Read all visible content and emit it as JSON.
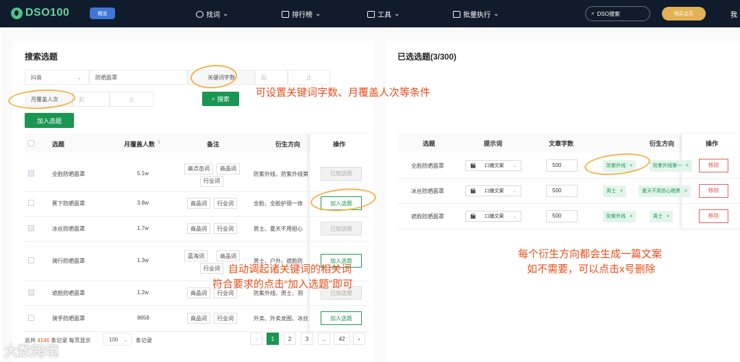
{
  "topbar": {
    "logo": "DSO100",
    "overview": "概览",
    "nav": [
      "找词",
      "排行榜",
      "工具",
      "批量执行"
    ],
    "search_placeholder": "DSO搜索",
    "buy": "购买会员",
    "me": "我"
  },
  "left": {
    "title": "搜索选题",
    "platform": "抖音",
    "keyword": "防晒面罩",
    "kw_len_label": "关键词字数",
    "kw_len_from": "起",
    "kw_len_to": "止",
    "cover_label": "月覆盖人次",
    "cover_from": "起",
    "cover_to": "止",
    "search_btn": "搜索",
    "add_btn": "加入选题",
    "headers": [
      "选题",
      "月覆盖人数",
      "备注",
      "衍生方向",
      "操作"
    ],
    "rows": [
      {
        "name": "全脸防晒面罩",
        "count": "5.1w",
        "tags": [
          "高点击词",
          "商品词",
          "行业词"
        ],
        "dir": "防紫外线、防紫外线第",
        "op": "已加选题",
        "disabled": true
      },
      {
        "name": "蕉下防晒面罩",
        "count": "3.8w",
        "tags": [
          "商品词",
          "行业词"
        ],
        "dir": "全脸、全脸护颈一体",
        "op": "加入选题",
        "disabled": false
      },
      {
        "name": "冰丝防晒面罩",
        "count": "1.7w",
        "tags": [
          "商品词",
          "行业词"
        ],
        "dir": "男士、夏天不用担心",
        "op": "已加选题",
        "disabled": true
      },
      {
        "name": "骑行防晒面罩",
        "count": "1.3w",
        "tags": [
          "蓝海词",
          "商品词",
          "行业词"
        ],
        "dir": "男士、户外、遮脸防",
        "op": "加入选题",
        "disabled": false
      },
      {
        "name": "遮脸防晒面罩",
        "count": "1.2w",
        "tags": [
          "商品词",
          "行业词"
        ],
        "dir": "防紫外线、男士、测",
        "op": "已加选题",
        "disabled": true
      },
      {
        "name": "骑手防晒面罩",
        "count": "9658",
        "tags": [
          "商品词",
          "行业词"
        ],
        "dir": "外卖、外卖龙图、冰丝",
        "op": "加入选题",
        "disabled": false
      }
    ],
    "footer": {
      "prefix": "总共",
      "total": "4146",
      "mid": "条记录 每页显示",
      "per": "100",
      "suffix": "条记录"
    },
    "pages": [
      "1",
      "2",
      "3",
      "...",
      "42"
    ]
  },
  "right": {
    "title": "已选选题(3/300)",
    "headers": [
      "选题",
      "提示词",
      "文章字数",
      "衍生方向",
      "操作"
    ],
    "rows": [
      {
        "name": "全脸防晒面罩",
        "prompt": "口播文案",
        "words": "500",
        "tags": [
          "防紫外线",
          "防紫外线第一"
        ],
        "op": "移除"
      },
      {
        "name": "冰丝防晒面罩",
        "prompt": "口播文案",
        "words": "500",
        "tags": [
          "男士",
          "夏天不用担心晒黑"
        ],
        "op": "移除"
      },
      {
        "name": "遮脸防晒面罩",
        "prompt": "口播文案",
        "words": "500",
        "tags": [
          "防紫外线",
          "男士"
        ],
        "op": "移除"
      }
    ]
  },
  "annotations": {
    "a1": "可设置关键词字数、月覆盖人次等条件",
    "a2_line1": "自动调起诸关键词的相关词",
    "a2_line2": "符合要求的点击“加入选题”即可",
    "a3_line1": "每个衍生方向都会生成一篇文案",
    "a3_line2": "如不需要，可以点击x号删除"
  },
  "watermark": "大数跨境",
  "colors": {
    "brand": "#1a9653",
    "annotation": "#e84d19",
    "topbar": "#101c2c"
  }
}
